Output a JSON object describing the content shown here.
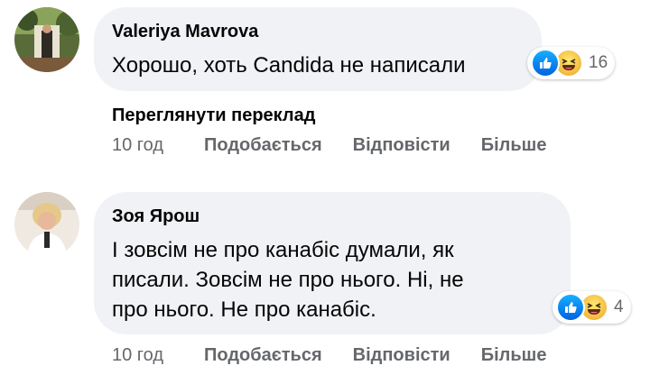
{
  "comments": [
    {
      "author": "Valeriya Mavrova",
      "lines": [
        "Хорошо, хоть Candida не написали"
      ],
      "reaction_count": "16",
      "see_translation": "Переглянути переклад",
      "time": "10 год",
      "like_label": "Подобається",
      "reply_label": "Відповісти",
      "more_label": "Більше"
    },
    {
      "author": "Зоя Ярош",
      "lines": [
        "І зовсім не про канабіс думали, як",
        "писали. Зовсім не про нього. Ні, не",
        "про нього. Не про канабіс."
      ],
      "reaction_count": "4",
      "time": "10 год",
      "like_label": "Подобається",
      "reply_label": "Відповісти",
      "more_label": "Більше"
    }
  ],
  "icons": {
    "like": "like-reaction-icon",
    "haha": "haha-reaction-icon"
  },
  "colors": {
    "bubble": "#f0f2f5",
    "meta_text": "#65676b",
    "like_blue": "#0062df"
  }
}
